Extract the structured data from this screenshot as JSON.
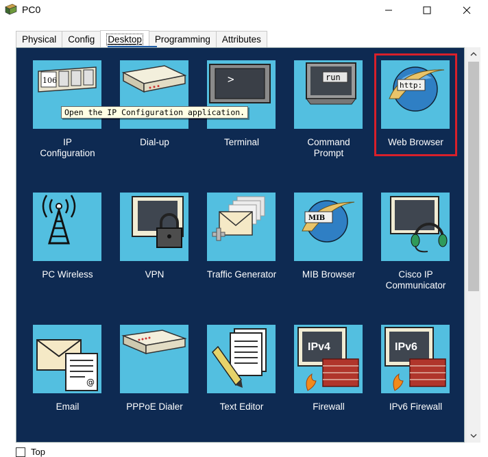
{
  "window": {
    "title": "PC0",
    "icon": "network-pc-icon"
  },
  "tabs": [
    {
      "label": "Physical"
    },
    {
      "label": "Config"
    },
    {
      "label": "Desktop",
      "active": true
    },
    {
      "label": "Programming"
    },
    {
      "label": "Attributes"
    }
  ],
  "tooltip": "Open the IP Configuration application.",
  "apps": [
    {
      "label": "IP\nConfiguration",
      "icon": "ip-configuration-icon",
      "tile_text": "106"
    },
    {
      "label": "Dial-up",
      "icon": "dial-up-modem-icon"
    },
    {
      "label": "Terminal",
      "icon": "terminal-icon",
      "tile_text": ">"
    },
    {
      "label": "Command\nPrompt",
      "icon": "command-prompt-icon",
      "tile_text": "run"
    },
    {
      "label": "Web Browser",
      "icon": "web-browser-icon",
      "tile_text": "http:",
      "highlighted": true
    },
    {
      "label": "PC Wireless",
      "icon": "wireless-antenna-icon"
    },
    {
      "label": "VPN",
      "icon": "vpn-lock-icon"
    },
    {
      "label": "Traffic Generator",
      "icon": "traffic-generator-icon"
    },
    {
      "label": "MIB Browser",
      "icon": "mib-browser-icon",
      "tile_text": "MIB"
    },
    {
      "label": "Cisco IP\nCommunicator",
      "icon": "ip-communicator-headset-icon"
    },
    {
      "label": "Email",
      "icon": "email-envelope-icon"
    },
    {
      "label": "PPPoE Dialer",
      "icon": "pppoe-dialer-icon"
    },
    {
      "label": "Text Editor",
      "icon": "text-editor-icon"
    },
    {
      "label": "Firewall",
      "icon": "firewall-ipv4-icon",
      "tile_text": "IPv4"
    },
    {
      "label": "IPv6 Firewall",
      "icon": "firewall-ipv6-icon",
      "tile_text": "IPv6"
    }
  ],
  "bottom": {
    "top_label": "Top"
  },
  "colors": {
    "panel_bg": "#0e2a52",
    "tile_bg": "#53bfe0",
    "highlight": "#d8202a"
  }
}
